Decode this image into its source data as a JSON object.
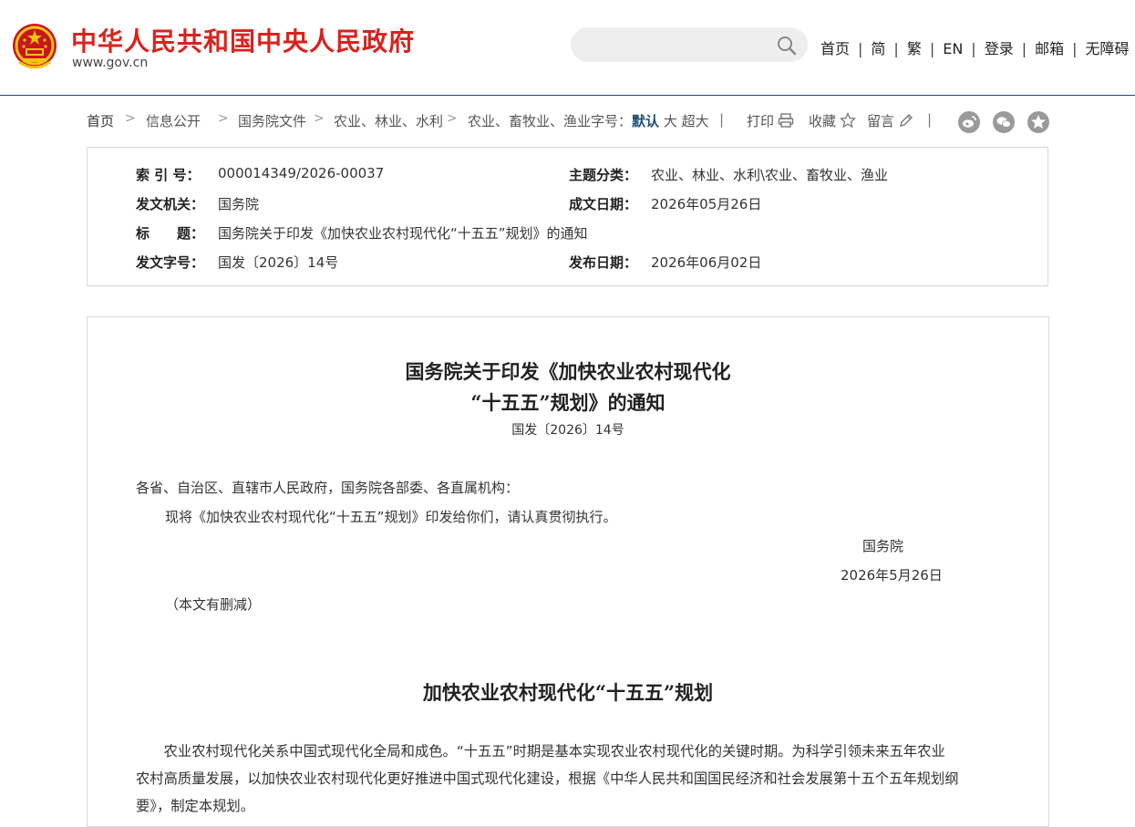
{
  "header": {
    "site_title": "中华人民共和国中央人民政府",
    "site_domain": "www.gov.cn",
    "search_placeholder": "",
    "nav": [
      "首页",
      "简",
      "繁",
      "EN",
      "登录",
      "邮箱",
      "无障碍"
    ]
  },
  "breadcrumb": {
    "items": [
      "首页",
      "信息公开",
      "国务院文件",
      "农业、林业、水利",
      "农业、畜牧业、渔业"
    ],
    "fontsize_label": "字号：",
    "fontsize_options": [
      "默认",
      "大",
      "超大"
    ],
    "print_label": "打印",
    "favorite_label": "收藏",
    "comment_label": "留言"
  },
  "share_icons": [
    "weibo-icon",
    "wechat-icon",
    "qzone-icon"
  ],
  "metadata": {
    "index_label": "索 引 号：",
    "index_value": "000014349/2026-00037",
    "topic_label": "主题分类：",
    "topic_value": "农业、林业、水利\\农业、畜牧业、渔业",
    "issuer_label": "发文机关：",
    "issuer_value": "国务院",
    "date_written_label": "成文日期：",
    "date_written_value": "2026年05月26日",
    "title_label": "标　　题：",
    "title_value": "国务院关于印发《加快农业农村现代化“十五五”规划》的通知",
    "doc_no_label": "发文字号：",
    "doc_no_value": "国发〔2026〕14号",
    "publish_date_label": "发布日期：",
    "publish_date_value": "2026年06月02日"
  },
  "article": {
    "title_line1": "国务院关于印发《加快农业农村现代化",
    "title_line2": "“十五五”规划》的通知",
    "doc_number": "国发〔2026〕14号",
    "salutation": "各省、自治区、直辖市人民政府，国务院各部委、各直属机构：",
    "instruction": "现将《加快农业农村现代化“十五五”规划》印发给你们，请认真贯彻执行。",
    "signer": "国务院",
    "sign_date": "2026年5月26日",
    "note": "（本文有删减）",
    "plan_title": "加快农业农村现代化“十五五”规划",
    "body_line1": "　　农业农村现代化关系中国式现代化全局和成色。“十五五”时期是基本实现农业农村现代化的关键时期。为科学引领未来五年农业",
    "body_line2": "农村高质量发展，以加快农业农村现代化更好推进中国式现代化建设，根据《中华人民共和国国民经济和社会发展第十五个五年规划纲",
    "body_line3": "要》，制定本规划。"
  }
}
